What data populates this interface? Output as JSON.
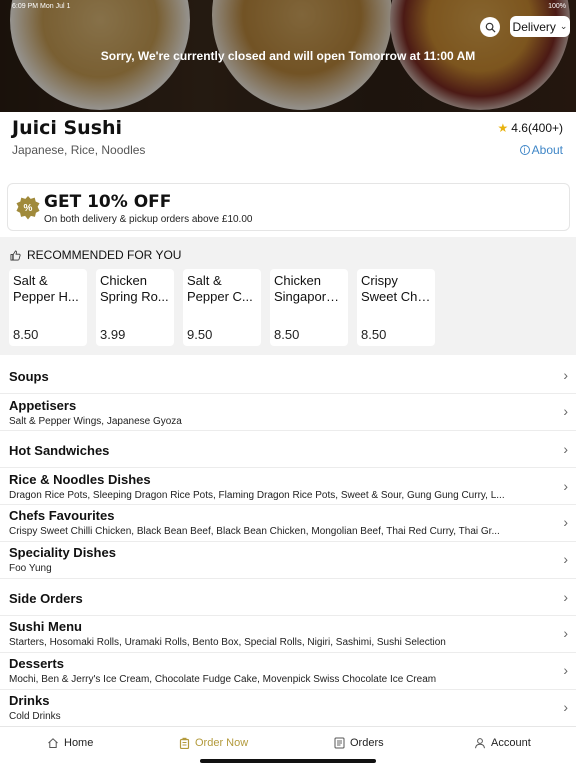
{
  "status_bar": {
    "left": "6:09 PM  Mon Jul 1",
    "right": "100%"
  },
  "hero": {
    "closed_message": "Sorry, We're currently closed and will open Tomorrow at 11:00 AM"
  },
  "header": {
    "search_icon": "search-icon",
    "delivery_label": "Delivery"
  },
  "store": {
    "name": "Juici Sushi",
    "cuisine": "Japanese, Rice, Noodles",
    "rating": "4.6(400+)",
    "about_label": "About"
  },
  "offer": {
    "title": "GET 10% OFF",
    "subtitle": "On both delivery & pickup orders above £10.00",
    "badge": "%"
  },
  "recommended": {
    "title": "RECOMMENDED FOR YOU",
    "items": [
      {
        "line1": "Salt &",
        "line2": "Pepper H...",
        "price": "8.50"
      },
      {
        "line1": "Chicken",
        "line2": "Spring Ro...",
        "price": "3.99"
      },
      {
        "line1": "Salt &",
        "line2": "Pepper C...",
        "price": "9.50"
      },
      {
        "line1": "Chicken",
        "line2": "Singapore...",
        "price": "8.50"
      },
      {
        "line1": "Crispy",
        "line2": "Sweet Chi...",
        "price": "8.50"
      }
    ]
  },
  "categories": [
    {
      "title": "Soups",
      "subtitle": ""
    },
    {
      "title": "Appetisers",
      "subtitle": "Salt & Pepper Wings, Japanese Gyoza"
    },
    {
      "title": "Hot Sandwiches",
      "subtitle": ""
    },
    {
      "title": "Rice & Noodles Dishes",
      "subtitle": "Dragon Rice Pots, Sleeping Dragon Rice Pots, Flaming Dragon Rice Pots, Sweet & Sour, Gung Gung Curry, L..."
    },
    {
      "title": "Chefs Favourites",
      "subtitle": "Crispy Sweet Chilli Chicken, Black Bean Beef, Black Bean Chicken, Mongolian Beef, Thai Red Curry, Thai Gr..."
    },
    {
      "title": "Speciality Dishes",
      "subtitle": "Foo Yung"
    },
    {
      "title": "Side Orders",
      "subtitle": ""
    },
    {
      "title": "Sushi Menu",
      "subtitle": "Starters, Hosomaki Rolls, Uramaki Rolls, Bento Box, Special Rolls, Nigiri, Sashimi, Sushi Selection"
    },
    {
      "title": "Desserts",
      "subtitle": "Mochi, Ben & Jerry's Ice Cream, Chocolate Fudge Cake, Movenpick Swiss Chocolate Ice Cream"
    },
    {
      "title": "Drinks",
      "subtitle": "Cold Drinks"
    }
  ],
  "bottom_nav": {
    "home": "Home",
    "order_now": "Order Now",
    "orders": "Orders",
    "account": "Account",
    "active": "order_now",
    "active_color": "#b39a3c"
  },
  "colors": {
    "accent": "#b39a3c",
    "link": "#3f86c7",
    "star": "#e8b20e"
  }
}
